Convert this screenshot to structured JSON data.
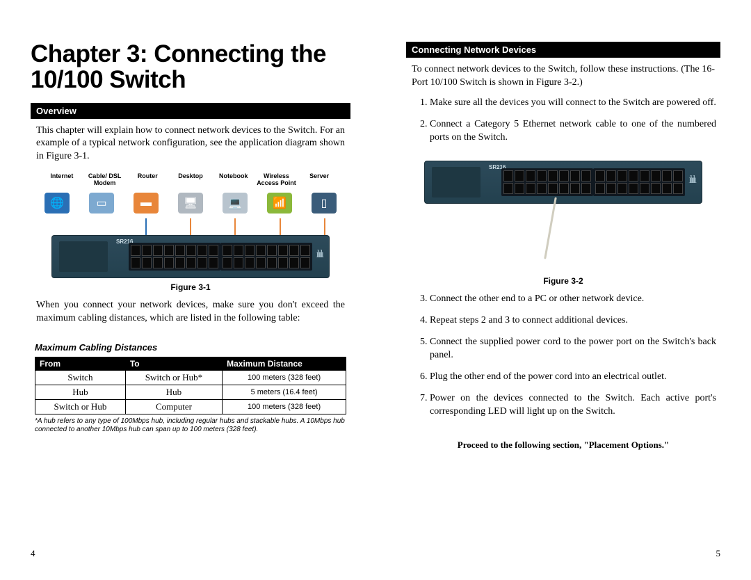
{
  "left": {
    "chapter_title": "Chapter 3: Connecting the 10/100 Switch",
    "overview_heading": "Overview",
    "overview_text": "This chapter will explain how to connect network devices to the Switch. For an example of a typical network configuration, see the application diagram shown in Figure 3-1.",
    "diagram_labels": [
      "Internet",
      "Cable/\nDSL Modem",
      "Router",
      "Desktop",
      "Notebook",
      "Wireless\nAccess Point",
      "Server"
    ],
    "figure1_caption": "Figure 3-1",
    "after_fig_text": "When you connect your network devices, make sure you don't exceed the maximum cabling distances, which are listed in the following table:",
    "table_title": "Maximum Cabling Distances",
    "table_headers": [
      "From",
      "To",
      "Maximum Distance"
    ],
    "table_rows": [
      [
        "Switch",
        "Switch or Hub*",
        "100 meters (328 feet)"
      ],
      [
        "Hub",
        "Hub",
        "5 meters (16.4 feet)"
      ],
      [
        "Switch or Hub",
        "Computer",
        "100 meters (328 feet)"
      ]
    ],
    "table_footnote": "*A hub refers to any type of 100Mbps hub, including regular hubs and stackable hubs. A 10Mbps hub connected to another 10Mbps hub can span up to 100 meters (328 feet).",
    "page_number": "4"
  },
  "right": {
    "section_heading": "Connecting Network Devices",
    "intro": "To connect network devices to the Switch, follow these instructions. (The 16-Port 10/100 Switch is shown in Figure 3-2.)",
    "step1": "Make sure all the devices you will connect to the Switch are powered off.",
    "step2": "Connect a Category 5 Ethernet network cable to one of the numbered ports on the Switch.",
    "figure2_caption": "Figure 3-2",
    "step3": "Connect the other end to a PC or other network device.",
    "step4": "Repeat steps 2 and 3 to connect additional devices.",
    "step5": "Connect the supplied power cord to the power port on the Switch's back panel.",
    "step6": "Plug the other end of the power cord into an electrical outlet.",
    "step7": "Power on the devices connected to the Switch. Each active port's corresponding LED will light up on the Switch.",
    "proceed": "Proceed to the following section, \"Placement Options.\"",
    "page_number": "5"
  },
  "device_model": "SR216"
}
